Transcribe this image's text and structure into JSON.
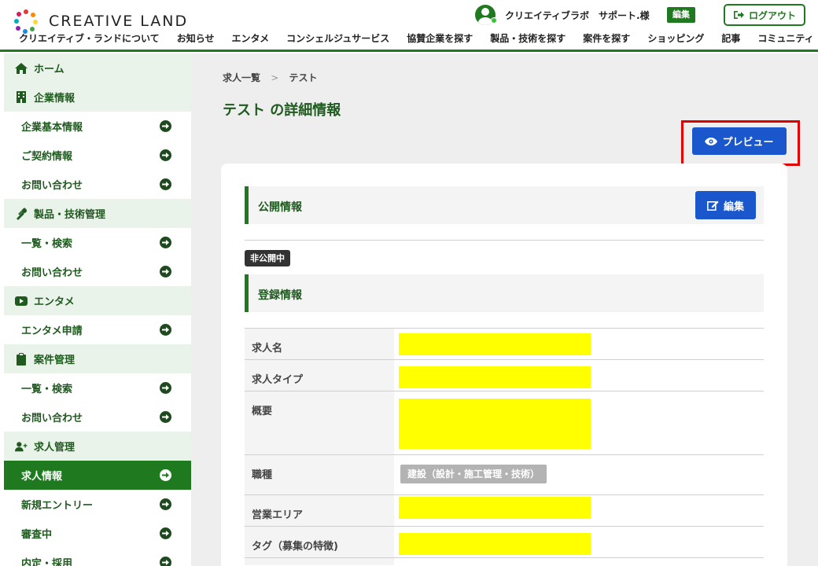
{
  "header": {
    "logo_text": "CREATIVE LAND",
    "user_company": "クリエイティブラボ",
    "user_name": "サポート.様",
    "edit_badge": "編集",
    "logout_label": "ログアウト",
    "nav": [
      "クリエイティブ・ランドについて",
      "お知らせ",
      "エンタメ",
      "コンシェルジュサービス",
      "協賛企業を探す",
      "製品・技術を探す",
      "案件を探す",
      "ショッピング",
      "記事",
      "コミュニティ"
    ]
  },
  "sidebar": {
    "items": [
      {
        "type": "head",
        "label": "ホーム",
        "icon": "home-icon"
      },
      {
        "type": "head",
        "label": "企業情報",
        "icon": "building-icon"
      },
      {
        "type": "sub",
        "label": "企業基本情報"
      },
      {
        "type": "sub",
        "label": "ご契約情報"
      },
      {
        "type": "sub",
        "label": "お問い合わせ"
      },
      {
        "type": "head",
        "label": "製品・技術管理",
        "icon": "tools-icon"
      },
      {
        "type": "sub",
        "label": "一覧・検索"
      },
      {
        "type": "sub",
        "label": "お問い合わせ"
      },
      {
        "type": "head",
        "label": "エンタメ",
        "icon": "video-icon"
      },
      {
        "type": "sub",
        "label": "エンタメ申請"
      },
      {
        "type": "head",
        "label": "案件管理",
        "icon": "clipboard-icon"
      },
      {
        "type": "sub",
        "label": "一覧・検索"
      },
      {
        "type": "sub",
        "label": "お問い合わせ"
      },
      {
        "type": "head",
        "label": "求人管理",
        "icon": "user-plus-icon"
      },
      {
        "type": "sub",
        "label": "求人情報",
        "active": true
      },
      {
        "type": "sub",
        "label": "新規エントリー"
      },
      {
        "type": "sub",
        "label": "審査中"
      },
      {
        "type": "sub",
        "label": "内定・採用"
      }
    ]
  },
  "main": {
    "breadcrumb": [
      "求人一覧",
      "テスト"
    ],
    "breadcrumb_sep": ">",
    "title": "テスト の詳細情報",
    "preview_label": "プレビュー",
    "public_section": "公開情報",
    "edit_label": "編集",
    "status_badge": "非公開中",
    "register_section": "登録情報",
    "rows": [
      {
        "label": "求人名",
        "kind": "redacted"
      },
      {
        "label": "求人タイプ",
        "kind": "redacted"
      },
      {
        "label": "概要",
        "kind": "redacted"
      },
      {
        "label": "職種",
        "kind": "tag",
        "value": "建設（設計・施工管理・技術）"
      },
      {
        "label": "営業エリア",
        "kind": "redacted"
      },
      {
        "label": "タグ（募集の特徴)",
        "kind": "redacted"
      }
    ]
  },
  "colors": {
    "brand_green": "#1f7a1f",
    "button_blue": "#1a57cc",
    "highlight_red": "#e00000",
    "redaction_yellow": "#ffff00"
  }
}
